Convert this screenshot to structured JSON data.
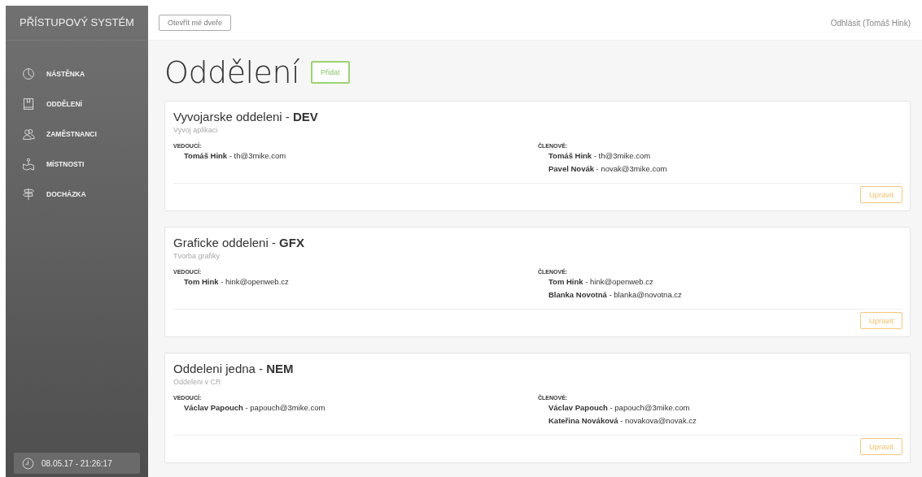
{
  "sidebar": {
    "title": "PŘÍSTUPOVÝ SYSTÉM",
    "items": [
      {
        "label": "NÁSTĚNKA"
      },
      {
        "label": "ODDĚLENÍ"
      },
      {
        "label": "ZAMĚSTNANCI"
      },
      {
        "label": "MÍSTNOSTI"
      },
      {
        "label": "DOCHÁZKA"
      }
    ],
    "clock": "08.05.17 - 21:26:17"
  },
  "topbar": {
    "open_button": "Otevřít mé dveře",
    "logout": "Odhlásit (Tomáš Hink)"
  },
  "page": {
    "title": "Oddělení",
    "add_button": "Přidat"
  },
  "departments": [
    {
      "title": "Vyvojarske oddeleni - **DEV**",
      "subtitle": "Vyvoj aplikaci",
      "leaders_label": "VEDOUCÍ:",
      "leaders": [
        "**Tomáš Hink** - th@3mike.com"
      ],
      "members_label": "ČLENOVÉ:",
      "members": [
        "**Tomáš Hink** - th@3mike.com",
        "**Pavel Novák** - novak@3mike.com"
      ],
      "edit_button": "Upravit"
    },
    {
      "title": "Graficke oddeleni - **GFX**",
      "subtitle": "Tvorba grafiky",
      "leaders_label": "VEDOUCÍ:",
      "leaders": [
        "**Tom Hink** - hink@openweb.cz"
      ],
      "members_label": "ČLENOVÉ:",
      "members": [
        "**Tom Hink** - hink@openweb.cz",
        "**Blanka Novotná** - blanka@novotna.cz"
      ],
      "edit_button": "Upravit"
    },
    {
      "title": "Oddeleni jedna - **NEM**",
      "subtitle": "Oddeleni v CR",
      "leaders_label": "VEDOUCÍ:",
      "leaders": [
        "**Václav Papouch** - papouch@3mike.com"
      ],
      "members_label": "ČLENOVÉ:",
      "members": [
        "**Václav Papouch** - papouch@3mike.com",
        "**Kateřina Nováková** - novakova@novak.cz"
      ],
      "edit_button": "Upravit"
    }
  ]
}
